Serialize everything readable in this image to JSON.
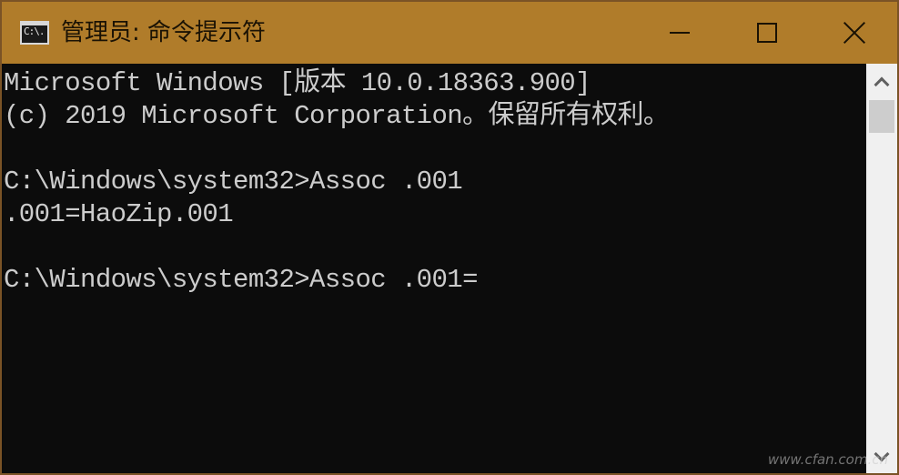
{
  "window": {
    "title": "管理员: 命令提示符",
    "icon_text": "C:\\.",
    "controls": {
      "minimize": "minimize-icon",
      "maximize": "maximize-icon",
      "close": "close-icon"
    }
  },
  "console": {
    "lines": [
      "Microsoft Windows [版本 10.0.18363.900]",
      "(c) 2019 Microsoft Corporation。保留所有权利。",
      "",
      "C:\\Windows\\system32>Assoc .001",
      ".001=HaoZip.001",
      "",
      "C:\\Windows\\system32>Assoc .001="
    ]
  },
  "colors": {
    "titlebar": "#b07c2a",
    "console_bg": "#0c0c0c",
    "console_text": "#cccccc"
  },
  "watermark": "www.cfan.com.cn"
}
